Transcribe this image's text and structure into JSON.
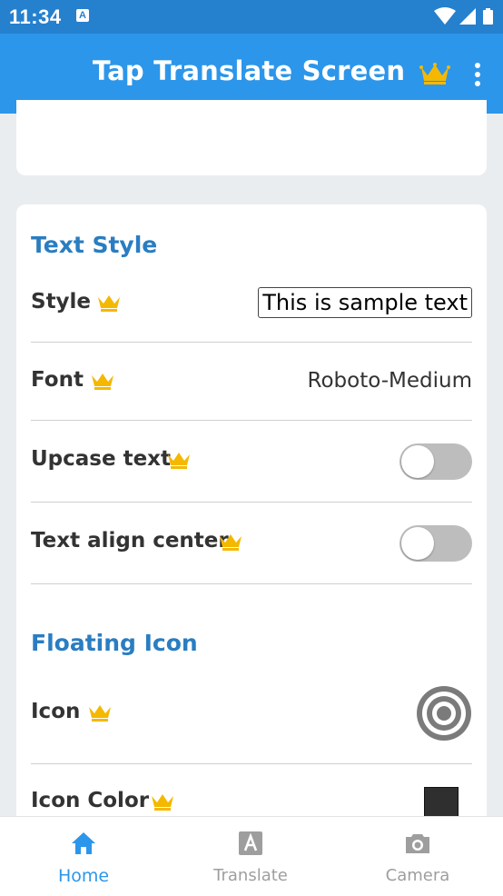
{
  "status_bar": {
    "time": "11:34",
    "notification_badge": "A"
  },
  "app_bar": {
    "title": "Tap Translate Screen",
    "icons": [
      "crown-icon",
      "more-vert-icon"
    ]
  },
  "text_style": {
    "section_title": "Text Style",
    "rows": [
      {
        "label": "Style",
        "value": "This is sample text"
      },
      {
        "label": "Font",
        "value": "Roboto-Medium"
      },
      {
        "label": "Upcase text",
        "toggle_on": false
      },
      {
        "label": "Text align center",
        "toggle_on": false
      }
    ]
  },
  "floating_icon": {
    "section_title": "Floating Icon",
    "rows": [
      {
        "label": "Icon",
        "icon": "target-icon"
      },
      {
        "label": "Icon Color",
        "color": "#2f2f2f"
      }
    ]
  },
  "bottom_nav": {
    "items": [
      {
        "label": "Home",
        "icon": "home-icon",
        "active": true
      },
      {
        "label": "Translate",
        "icon": "translate-icon",
        "active": false
      },
      {
        "label": "Camera",
        "icon": "camera-icon",
        "active": false
      }
    ]
  },
  "colors": {
    "status_bar": "#2580ce",
    "app_bar": "#2c96ea",
    "section_title": "#2a7dc1",
    "crown": "#f5b800",
    "active_nav": "#2c96ea"
  }
}
